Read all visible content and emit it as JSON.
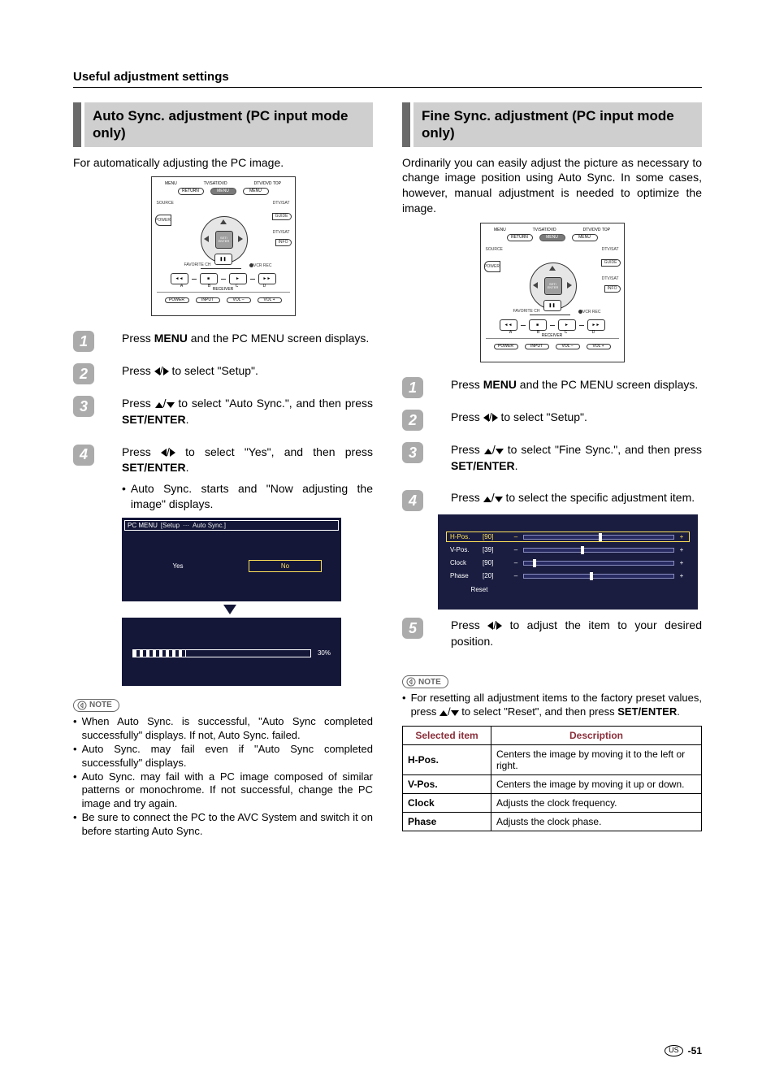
{
  "page": {
    "heading": "Useful adjustment settings",
    "number": "-51",
    "region": "US"
  },
  "left": {
    "title": "Auto Sync. adjustment (PC input mode only)",
    "intro": "For automatically adjusting the PC image.",
    "steps": {
      "s1": {
        "num": "1",
        "text_a": "Press ",
        "text_b": "MENU",
        "text_c": " and the PC MENU screen displays."
      },
      "s2": {
        "num": "2",
        "text_a": "Press ",
        "text_b": " to select \"Setup\"."
      },
      "s3": {
        "num": "3",
        "text_a": "Press ",
        "text_b": " to select \"Auto Sync.\", and then press ",
        "text_c": "SET/ENTER",
        "text_d": "."
      },
      "s4": {
        "num": "4",
        "text_a": "Press ",
        "text_b": " to select \"Yes\", and then press ",
        "text_c": "SET/ENTER",
        "text_d": ".",
        "sub": "Auto Sync. starts and \"Now adjusting the image\" displays."
      }
    },
    "osd": {
      "crumb_root": "PC MENU",
      "crumb_a": "[Setup",
      "crumb_b": "Auto Sync.]",
      "yes": "Yes",
      "no": "No",
      "percent": "30%"
    },
    "note_label": "NOTE",
    "notes": {
      "n1": "When Auto Sync. is successful, \"Auto Sync completed successfully\" displays. If not, Auto Sync. failed.",
      "n2": "Auto Sync. may fail even if \"Auto Sync completed successfully\" displays.",
      "n3": "Auto Sync. may fail with a PC image composed of similar patterns or monochrome. If not successful, change the PC image and try again.",
      "n4": "Be sure to connect the PC to the AVC System and switch it on before starting Auto Sync."
    }
  },
  "right": {
    "title": "Fine Sync. adjustment (PC input mode only)",
    "intro": "Ordinarily you can easily adjust the picture as necessary to change image position using Auto Sync. In some cases, however, manual adjustment is needed to optimize the image.",
    "steps": {
      "s1": {
        "num": "1",
        "text_a": "Press ",
        "text_b": "MENU",
        "text_c": " and the PC MENU screen displays."
      },
      "s2": {
        "num": "2",
        "text_a": "Press ",
        "text_b": " to select \"Setup\"."
      },
      "s3": {
        "num": "3",
        "text_a": "Press ",
        "text_b": " to select \"Fine Sync.\", and then press ",
        "text_c": "SET/ENTER",
        "text_d": "."
      },
      "s4": {
        "num": "4",
        "text_a": "Press ",
        "text_b": " to select the specific adjustment item."
      },
      "s5": {
        "num": "5",
        "text_a": "Press ",
        "text_b": " to adjust the item to your desired position."
      }
    },
    "fs": {
      "rows": [
        {
          "name": "H-Pos.",
          "val": "[90]",
          "handle_pct": 50
        },
        {
          "name": "V-Pos.",
          "val": "[39]",
          "handle_pct": 38
        },
        {
          "name": "Clock",
          "val": "[90]",
          "handle_pct": 6
        },
        {
          "name": "Phase",
          "val": "[20]",
          "handle_pct": 44
        }
      ],
      "reset": "Reset"
    },
    "note_label": "NOTE",
    "note_text_a": "For resetting all adjustment items to the factory preset values, press ",
    "note_text_b": " to select \"Reset\", and then press ",
    "note_text_c": "SET/ENTER",
    "note_text_d": ".",
    "table": {
      "h1": "Selected item",
      "h2": "Description",
      "rows": [
        {
          "k": "H-Pos.",
          "v": "Centers the image by moving it to the left or right."
        },
        {
          "k": "V-Pos.",
          "v": "Centers the image by moving it up or down."
        },
        {
          "k": "Clock",
          "v": "Adjusts the clock frequency."
        },
        {
          "k": "Phase",
          "v": "Adjusts the clock phase."
        }
      ]
    }
  },
  "remote": {
    "head": [
      "MENU",
      "TV/SAT/DVD",
      "DTV/DVD TOP"
    ],
    "r1": [
      "RETURN",
      "MENU",
      "MENU"
    ],
    "source": "SOURCE",
    "power": "POWER",
    "dtvsat": "DTV/SAT",
    "guide": "GUIDE",
    "dtvsat2": "DTV/SAT",
    "info": "INFO",
    "set": "SET/",
    "enter": "ENTER",
    "favch": "FAVORITE CH",
    "vcrrec": "VCR REC",
    "abcd": [
      "A",
      "B",
      "C",
      "D"
    ],
    "receiver": "RECEIVER",
    "bottom": [
      "POWER",
      "INPUT",
      "VOL –",
      "VOL +"
    ]
  }
}
